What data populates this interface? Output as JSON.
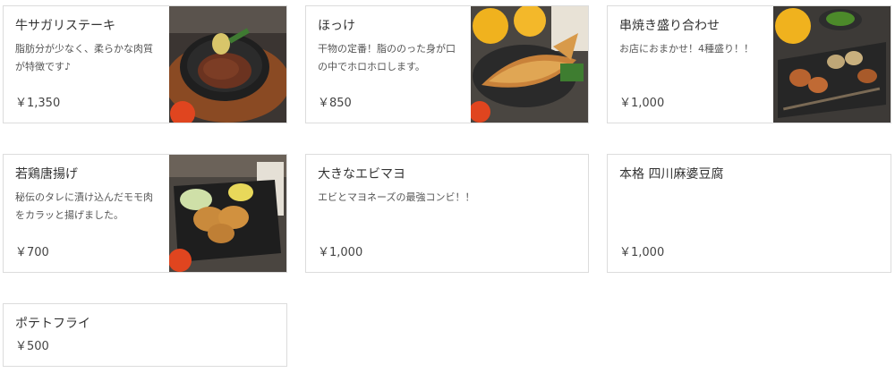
{
  "menu": {
    "items": [
      {
        "name": "牛サガリステーキ",
        "description": "脂肪分が少なく、柔らかな肉質が特徴です♪",
        "price": "￥1,350",
        "photo": "steak-plate-photo"
      },
      {
        "name": "ほっけ",
        "description": "干物の定番！脂ののった身が口の中でホロホロします。",
        "price": "￥850",
        "photo": "grilled-hokke-fish-photo"
      },
      {
        "name": "串焼き盛り合わせ",
        "description": "お店におまかせ！4種盛り！！",
        "price": "￥1,000",
        "photo": "skewer-platter-photo"
      },
      {
        "name": "若鶏唐揚げ",
        "description": "秘伝のタレに漬け込んだモモ肉をカラッと揚げました。",
        "price": "￥700",
        "photo": "fried-chicken-photo"
      },
      {
        "name": "大きなエビマヨ",
        "description": "エビとマヨネーズの最強コンビ！！",
        "price": "￥1,000"
      },
      {
        "name": "本格 四川麻婆豆腐",
        "description": "",
        "price": "￥1,000"
      },
      {
        "name": "ポテトフライ",
        "description": "",
        "price": "￥500"
      }
    ]
  }
}
